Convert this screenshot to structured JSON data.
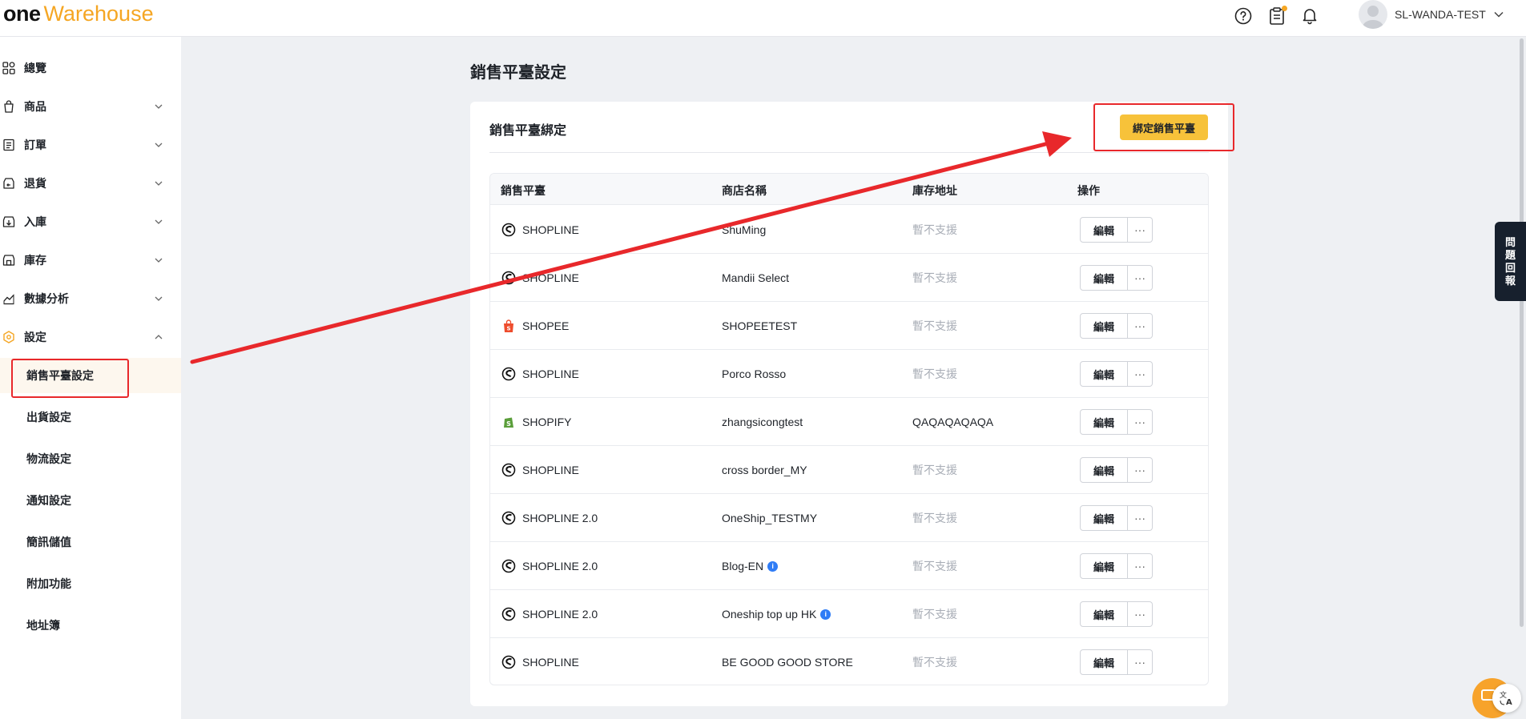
{
  "header": {
    "logo_one": "one",
    "logo_warehouse": "Warehouse",
    "user_name": "SL-WANDA-TEST",
    "icons": [
      "help-circle-icon",
      "clipboard-icon",
      "bell-icon",
      "avatar-icon",
      "chevron-down-icon"
    ]
  },
  "sidebar": {
    "items": [
      {
        "label": "總覽",
        "icon": "overview-grid-icon",
        "expandable": false
      },
      {
        "label": "商品",
        "icon": "product-bag-icon",
        "expandable": true
      },
      {
        "label": "訂單",
        "icon": "order-list-icon",
        "expandable": true
      },
      {
        "label": "退貨",
        "icon": "return-icon",
        "expandable": true
      },
      {
        "label": "入庫",
        "icon": "inbound-icon",
        "expandable": true
      },
      {
        "label": "庫存",
        "icon": "inventory-icon",
        "expandable": true
      },
      {
        "label": "數據分析",
        "icon": "analytics-chart-icon",
        "expandable": true
      },
      {
        "label": "設定",
        "icon": "settings-gear-icon",
        "expandable": true,
        "expanded": true
      }
    ],
    "sub_items": [
      {
        "label": "銷售平臺設定",
        "active": true
      },
      {
        "label": "出貨設定"
      },
      {
        "label": "物流設定"
      },
      {
        "label": "通知設定"
      },
      {
        "label": "簡訊儲值"
      },
      {
        "label": "附加功能"
      },
      {
        "label": "地址簿"
      }
    ]
  },
  "main": {
    "page_title": "銷售平臺設定",
    "card_title": "銷售平臺綁定",
    "bind_button": "綁定銷售平臺",
    "columns": [
      "銷售平臺",
      "商店名稱",
      "庫存地址",
      "操作"
    ],
    "rows": [
      {
        "platform": "SHOPLINE",
        "icon": "shopline-icon",
        "store": "ShuMing",
        "address": "暫不支援",
        "address_muted": true,
        "info": false
      },
      {
        "platform": "SHOPLINE",
        "icon": "shopline-icon",
        "store": "Mandii Select",
        "address": "暫不支援",
        "address_muted": true,
        "info": false
      },
      {
        "platform": "SHOPEE",
        "icon": "shopee-icon",
        "store": "SHOPEETEST",
        "address": "暫不支援",
        "address_muted": true,
        "info": false
      },
      {
        "platform": "SHOPLINE",
        "icon": "shopline-icon",
        "store": "Porco Rosso",
        "address": "暫不支援",
        "address_muted": true,
        "info": false
      },
      {
        "platform": "SHOPIFY",
        "icon": "shopify-icon",
        "store": "zhangsicongtest",
        "address": "QAQAQAQAQA",
        "address_muted": false,
        "info": false
      },
      {
        "platform": "SHOPLINE",
        "icon": "shopline-icon",
        "store": "cross border_MY",
        "address": "暫不支援",
        "address_muted": true,
        "info": false
      },
      {
        "platform": "SHOPLINE 2.0",
        "icon": "shopline-icon",
        "store": "OneShip_TESTMY",
        "address": "暫不支援",
        "address_muted": true,
        "info": false
      },
      {
        "platform": "SHOPLINE 2.0",
        "icon": "shopline-icon",
        "store": "Blog-EN",
        "address": "暫不支援",
        "address_muted": true,
        "info": true
      },
      {
        "platform": "SHOPLINE 2.0",
        "icon": "shopline-icon",
        "store": "Oneship top up HK",
        "address": "暫不支援",
        "address_muted": true,
        "info": true
      },
      {
        "platform": "SHOPLINE",
        "icon": "shopline-icon",
        "store": "BE GOOD GOOD STORE",
        "address": "暫不支援",
        "address_muted": true,
        "info": false
      }
    ],
    "edit_label": "編輯",
    "more_label": "···",
    "info_glyph": "i"
  },
  "feedback": {
    "chars": [
      "問",
      "題",
      "回",
      "報"
    ]
  },
  "colors": {
    "brand": "#f5a623",
    "button": "#f7c23a",
    "annotation": "#e8282b",
    "feedback_bg": "#17202d"
  }
}
